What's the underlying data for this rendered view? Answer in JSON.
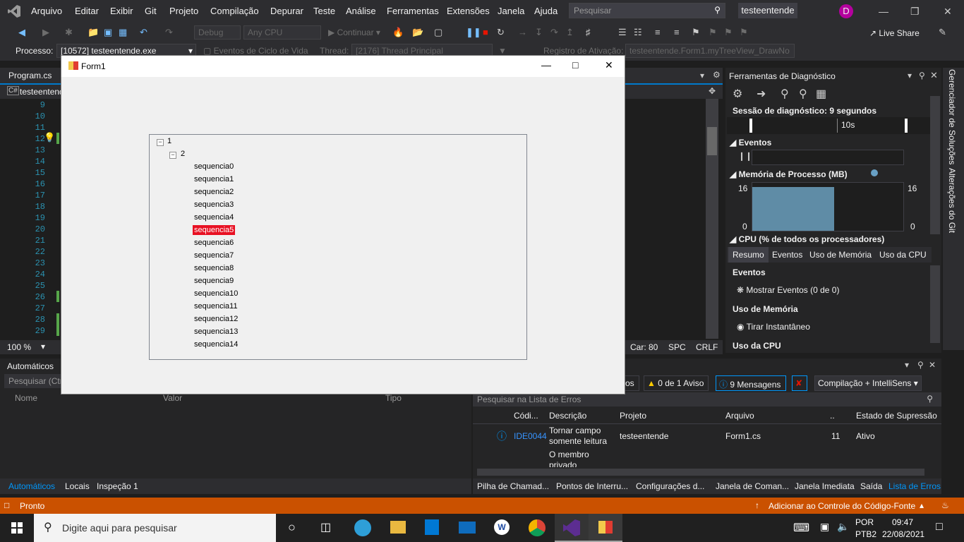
{
  "menu": [
    "Arquivo",
    "Editar",
    "Exibir",
    "Git",
    "Projeto",
    "Compilação",
    "Depurar",
    "Teste",
    "Análise",
    "Ferramentas",
    "Extensões",
    "Janela",
    "Ajuda"
  ],
  "search": {
    "placeholder": "Pesquisar"
  },
  "solution_name": "testeentende",
  "avatar": "D",
  "toolbar": {
    "debug": "Debug",
    "cpu": "Any CPU",
    "continue": "Continuar",
    "live_share": "Live Share"
  },
  "debugbar": {
    "process_label": "Processo:",
    "process": "[10572] testeentende.exe",
    "lifecycle": "Eventos de Ciclo de Vida",
    "thread_label": "Thread:",
    "thread": "[2176] Thread Principal",
    "stack_label": "Registro de Ativação:",
    "stack": "testeentende.Form1.myTreeView_DrawNo"
  },
  "editor": {
    "tab": "Program.cs",
    "file": "testeentende",
    "zoom": "100 %",
    "lines": [
      "9",
      "10",
      "11",
      "12",
      "13",
      "14",
      "15",
      "16",
      "17",
      "18",
      "19",
      "20",
      "21",
      "22",
      "23",
      "24",
      "25",
      "26",
      "27",
      "28",
      "29"
    ],
    "col_label": "Car: 80",
    "spc": "SPC",
    "crlf": "CRLF"
  },
  "form": {
    "title": "Form1",
    "root": "1",
    "child": "2",
    "items": [
      "sequencia0",
      "sequencia1",
      "sequencia2",
      "sequencia3",
      "sequencia4",
      "sequencia5",
      "sequencia6",
      "sequencia7",
      "sequencia8",
      "sequencia9",
      "sequencia10",
      "sequencia11",
      "sequencia12",
      "sequencia13",
      "sequencia14"
    ],
    "selected_index": 5
  },
  "diag": {
    "title": "Ferramentas de Diagnóstico",
    "session": "Sessão de diagnóstico: 9 segundos",
    "time_label": "10s",
    "events": "Eventos",
    "memory": "Memória de Processo (MB)",
    "mem_max": "16",
    "mem_min": "0",
    "cpu": "CPU (% de todos os processadores)",
    "tabs": [
      "Resumo",
      "Eventos",
      "Uso de Memória",
      "Uso da CPU"
    ],
    "s_events": "Eventos",
    "show_events": "Mostrar Eventos (0 de 0)",
    "s_memory": "Uso de Memória",
    "snapshot": "Tirar Instantâneo",
    "s_cpu": "Uso da CPU"
  },
  "side_tabs": [
    "Gerenciador de Soluções",
    "Alterações do Git"
  ],
  "autos": {
    "title": "Automáticos",
    "search": "Pesquisar (Ctr",
    "cols": [
      "Nome",
      "Valor",
      "Tipo"
    ],
    "tabs": [
      "Automáticos",
      "Locais",
      "Inspeção 1"
    ]
  },
  "errors": {
    "fragment": "os",
    "warnings": "0 de 1 Aviso",
    "messages": "9 Mensagens",
    "build": "Compilação + IntelliSens",
    "search": "Pesquisar na Lista de Erros",
    "cols": [
      "Códi...",
      "Descrição",
      "Projeto",
      "Arquivo",
      "..",
      "Estado de Supressão"
    ],
    "row": {
      "code": "IDE0044",
      "desc1": "Tornar campo",
      "desc2": "somente leitura",
      "project": "testeentende",
      "file": "Form1.cs",
      "line": "11",
      "state": "Ativo"
    },
    "row2": {
      "desc1": "O membro",
      "desc2": "privado"
    },
    "tabs": [
      "Pilha de Chamad...",
      "Pontos de Interru...",
      "Configurações d...",
      "Janela de Coman...",
      "Janela Imediata",
      "Saída",
      "Lista de Erros"
    ]
  },
  "status": {
    "ready": "Pronto",
    "source": "Adicionar ao Controle do Código-Fonte"
  },
  "taskbar": {
    "search": "Digite aqui para pesquisar",
    "lang": "POR",
    "kbd": "PTB2",
    "time": "09:47",
    "date": "22/08/2021"
  }
}
